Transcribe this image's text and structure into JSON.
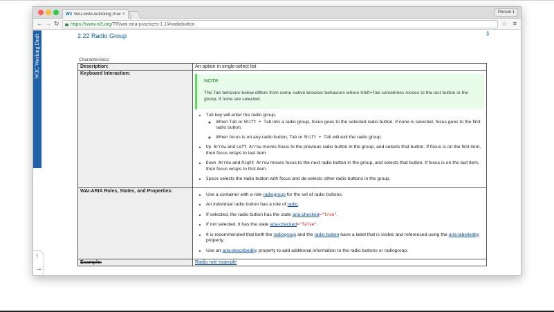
{
  "browser": {
    "tab_title": "WAI-ARIA Authoring Practi…",
    "favicon": "W3",
    "tab_close": "×",
    "person_label": "Person 1",
    "url_secure": "https://",
    "url_host": "www.w3.org",
    "url_path": "/TR/wai-aria-practices-1.1/#radiobutton",
    "back_icon": "←",
    "forward_icon": "→",
    "reload_icon": "↻",
    "star_icon": "☆",
    "menu_icon": "≡"
  },
  "page": {
    "ribbon_text": "W3C Working Draft",
    "section_title": "2.22 Radio Group",
    "section_mark": "§",
    "caption": "Characteristics:",
    "scroll_up_icon": "↑",
    "scroll_right_icon": "→",
    "rows": {
      "description": {
        "label": "Description:",
        "value": "An option in single-select list"
      },
      "keyboard": {
        "label": "Keyboard Interaction:",
        "note_title": "NOTE",
        "note_text": "The Tab behavior below differs from some native browser behaviors where Shift+Tab sometimes moves to the last button in the group, if none are selected.",
        "b1_key": "Tab",
        "b1_text": " key will enter the radio group.",
        "b1_s1_pre": "When ",
        "b1_s1_k1": "Tab",
        "b1_s1_mid": " or ",
        "b1_s1_k2": "Shift + Tab",
        "b1_s1_post": " into a radio group, focus goes to the selected radio button. If none is selected, focus goes to the first radio button.",
        "b1_s2_pre": "When focus is on any radio button, ",
        "b1_s2_k1": "Tab",
        "b1_s2_mid": " or ",
        "b1_s2_k2": "Shift + Tab",
        "b1_s2_post": " will exit the radio group.",
        "b2_k1": "Up Arrow",
        "b2_mid": " and ",
        "b2_k2": "Left Arrow",
        "b2_post": " moves focus to the previous radio button in the group, and selects that button. If focus is on the first item, then focus wraps to last item.",
        "b3_k1": "Down Arrow",
        "b3_mid": " and ",
        "b3_k2": "Right Arrow",
        "b3_post": " moves focus to the next radio button in the group, and selects that button. If focus is on the last item, then focus wraps to first item.",
        "b4_k": "Space",
        "b4_post": " selects the radio button with focus and de-selects other radio buttons in the group."
      },
      "roles": {
        "label": "WAI-ARIA Roles, States, and Properties:",
        "r1_pre": "Use a container with a role ",
        "r1_link": "radiogroup",
        "r1_post": " for the set of radio buttons.",
        "r2_pre": "An individual radio button has a role of ",
        "r2_link": "radio",
        "r2_post": ".",
        "r3_pre": "If selected, the radio button has the state ",
        "r3_link": "aria-checked",
        "r3_code": "=\"true\"",
        "r3_post": ".",
        "r4_pre": "If not selected, it has the state ",
        "r4_link": "aria-checked",
        "r4_code": "=\"false\"",
        "r4_post": ".",
        "r5_pre": "It is recommended that both the ",
        "r5_link1": "radiogroup",
        "r5_mid": " and the ",
        "r5_link2": "radio button",
        "r5_post": " have a label that is visible and referenced using the ",
        "r5_link3": "aria-labelledby",
        "r5_end": " property.",
        "r6_pre": "Use an ",
        "r6_link": "aria-describedby",
        "r6_post": " property to add additional information to the radio buttons or radiogroup."
      },
      "example": {
        "label": "Example:",
        "link": "Radio role example"
      }
    }
  }
}
